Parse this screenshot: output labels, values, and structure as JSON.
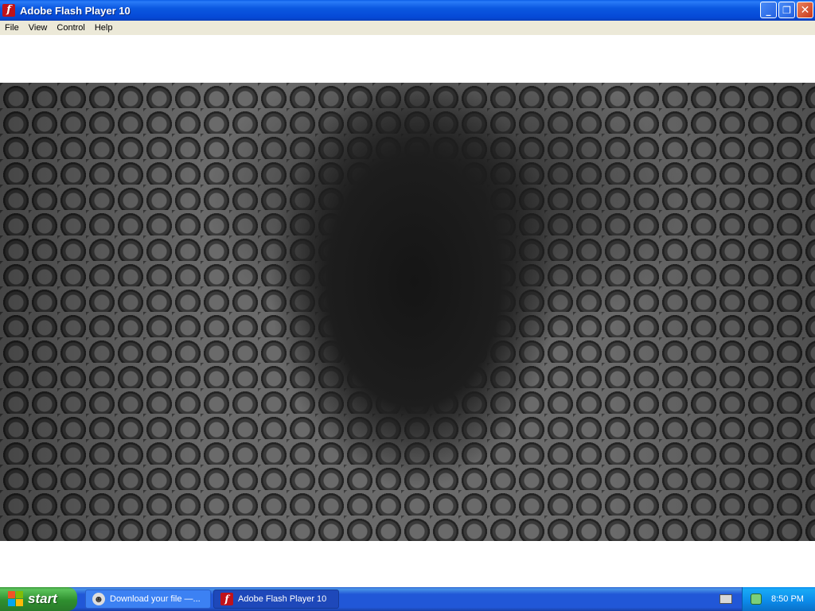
{
  "window": {
    "title": "Adobe Flash Player 10",
    "icon": "flash-icon",
    "controls": {
      "minimize": "_",
      "maximize": "❐",
      "close": "✕"
    }
  },
  "menu": {
    "items": [
      "File",
      "View",
      "Control",
      "Help"
    ]
  },
  "stage": {
    "description_icon": "game-canvas"
  },
  "taskbar": {
    "start_label": "start",
    "tasks": [
      {
        "label": "Download your file —...",
        "icon": "download-icon"
      },
      {
        "label": "Adobe Flash Player 10",
        "icon": "flash-icon"
      }
    ],
    "clock": "8:50 PM"
  },
  "colors": {
    "titlebar": "#0548d6",
    "menubar": "#ece9d8",
    "taskbar": "#2157d7",
    "start": "#2f8f2f",
    "tray": "#0c8ae8"
  }
}
